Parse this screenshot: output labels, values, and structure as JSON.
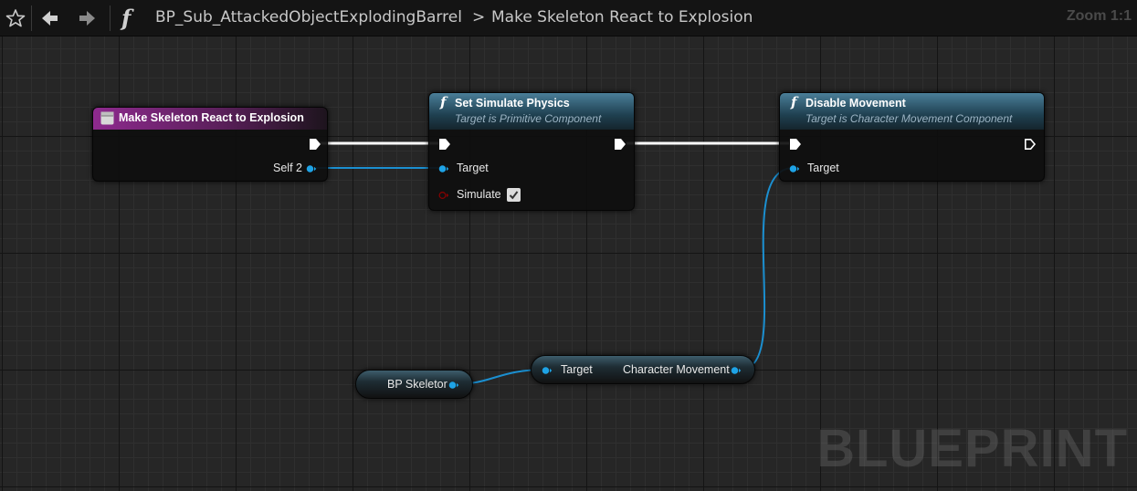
{
  "breadcrumb": {
    "blueprint": "BP_Sub_AttackedObjectExplodingBarrel",
    "separator": ">",
    "graph": "Make Skeleton React to Explosion"
  },
  "zoom_label": "Zoom 1:1",
  "watermark": "BLUEPRINT",
  "colors": {
    "exec_wire": "#ffffff",
    "object_pin": "#1ea3e6",
    "bool_pin": "#8c0000",
    "function_header": "#2c5a70",
    "event_header": "#8e2a8e"
  },
  "icons": {
    "favorite": "star-outline-icon",
    "back": "back-arrow-icon",
    "forward": "forward-arrow-icon",
    "function": "function-icon"
  },
  "nodes": {
    "event": {
      "title": "Make Skeleton React to Explosion",
      "output_pin": "Self 2"
    },
    "set_simulate_physics": {
      "fn_glyph": "f",
      "title": "Set Simulate Physics",
      "subtitle": "Target is Primitive Component",
      "target_pin": "Target",
      "simulate_pin": "Simulate",
      "simulate_checked": true
    },
    "disable_movement": {
      "fn_glyph": "f",
      "title": "Disable Movement",
      "subtitle": "Target is Character Movement Component",
      "target_pin": "Target"
    },
    "bp_skeleton": {
      "label": "BP Skeletor"
    },
    "character_movement": {
      "target_pin": "Target",
      "output_pin": "Character Movement"
    }
  }
}
